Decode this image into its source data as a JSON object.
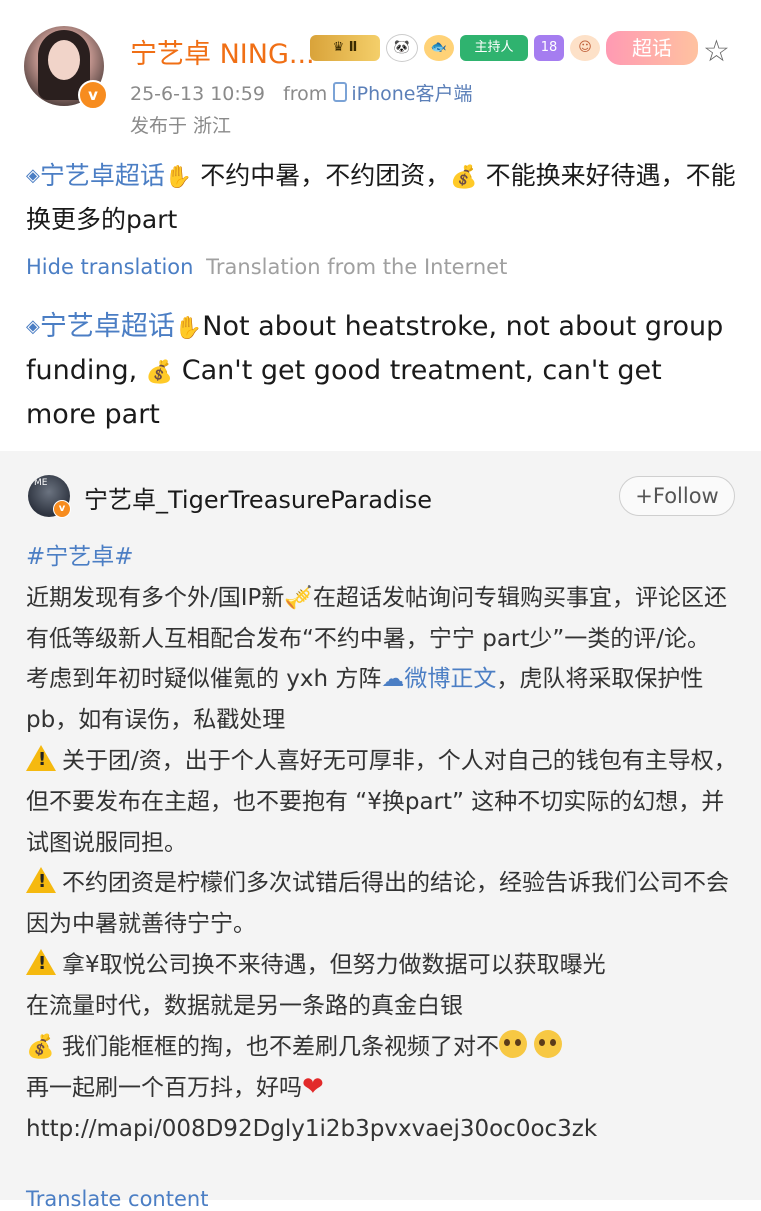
{
  "post": {
    "username": "宁艺卓 NING...",
    "badges": {
      "crown": "♛ Ⅱ",
      "panda": "🐼",
      "fish": "🐟",
      "host": "主持人",
      "level": "18",
      "face": "☺",
      "super": "超话"
    },
    "timestamp": "25-6-13 10:59",
    "from_label": "from",
    "source": "iPhone客户端",
    "region": "发布于 浙江",
    "topic": "宁艺卓超话",
    "text_part1": " 不约中暑，不约团资，",
    "text_part2": " 不能换来好待遇，不能换更多的part",
    "hide_translation": "Hide translation",
    "translation_source": "Translation from the Internet",
    "translation_part1": "Not about heatstroke, not about group funding, ",
    "translation_part2": " Can't get good treatment, can't get more part"
  },
  "repost": {
    "username": "宁艺卓_TigerTreasureParadise",
    "avatar_text": "ME",
    "follow_label": "Follow",
    "hashtag": "#宁艺卓#",
    "line1a": "近期发现有多个外/国IP新",
    "line1b": "在超话发帖询问专辑购买事宜，评论区还有低等级新人互相配合发布“不约中暑，宁宁 part少”一类的评/论。",
    "line2a": "考虑到年初时疑似催氪的 yxh 方阵",
    "weibo_link": "微博正文",
    "line2b": "，虎队将采取保护性pb，如有误伤，私戳处理",
    "line3": "关于团/资，出于个人喜好无可厚非，个人对自己的钱包有主导权，但不要发布在主超，也不要抱有 “¥换part” 这种不切实际的幻想，并试图说服同担。",
    "line4": "不约团资是柠檬们多次试错后得出的结论，经验告诉我们公司不会因为中暑就善待宁宁。",
    "line5": "拿¥取悦公司换不来待遇，但努力做数据可以获取曝光",
    "line6": "在流量时代，数据就是另一条路的真金白银",
    "line7": " 我们能框框的掏，也不差刷几条视频了对不",
    "line8a": "再一起刷一个百万抖，好吗",
    "link": " http://mapi/008D92Dgly1i2b3pvxvaej30oc0oc3zk",
    "footer": "Translate content"
  },
  "colors": {
    "username_orange": "#f06f15",
    "link_blue": "#4b7ec4",
    "repost_bg": "#f4f4f4"
  }
}
